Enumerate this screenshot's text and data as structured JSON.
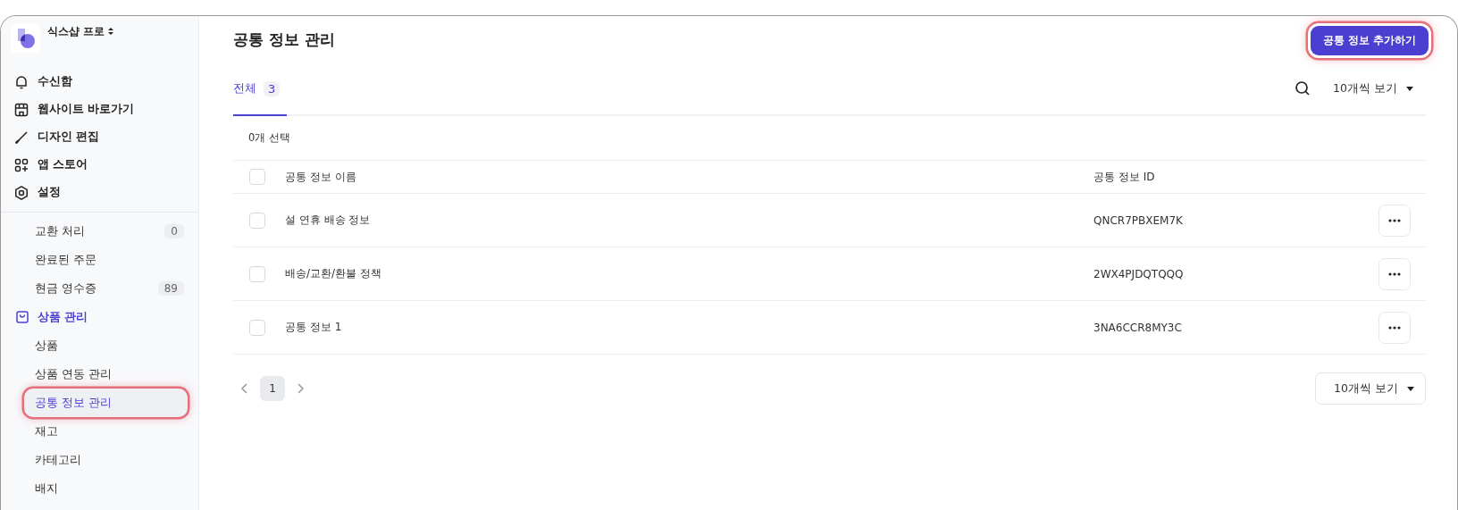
{
  "sidebar": {
    "store_name": "식스샵 프로",
    "nav": [
      {
        "label": "수신함"
      },
      {
        "label": "웹사이트 바로가기"
      },
      {
        "label": "디자인 편집"
      },
      {
        "label": "앱 스토어"
      },
      {
        "label": "설정"
      }
    ],
    "order_items": [
      {
        "label": "교환 처리",
        "count": "0",
        "selected": false
      },
      {
        "label": "완료된 주문",
        "selected": false
      },
      {
        "label": "현금 영수증",
        "count": "89",
        "selected": false
      }
    ],
    "product_section": {
      "label": "상품 관리",
      "selected": true,
      "children": [
        {
          "label": "상품",
          "selected": false,
          "highlighted": false
        },
        {
          "label": "상품 연동 관리",
          "selected": false,
          "highlighted": false
        },
        {
          "label": "공통 정보 관리",
          "selected": true,
          "highlighted": true
        },
        {
          "label": "재고",
          "selected": false,
          "highlighted": false
        },
        {
          "label": "카테고리",
          "selected": false,
          "highlighted": false
        },
        {
          "label": "배지",
          "selected": false,
          "highlighted": false
        }
      ]
    }
  },
  "page": {
    "title": "공통 정보 관리",
    "add_button": {
      "label": "공통 정보 추가하기",
      "highlighted": true
    }
  },
  "tabs": [
    {
      "label": "전체",
      "count": "3",
      "selected": true
    }
  ],
  "page_size_top": "10개씩 보기",
  "selection": "0개 선택",
  "table": {
    "header_checked": false,
    "columns": [
      "공통 정보 이름",
      "공통 정보 ID"
    ],
    "rows": [
      {
        "name": "설 연휴 배송 정보",
        "id": "QNCR7PBXEM7K",
        "checked": false
      },
      {
        "name": "배송/교환/환불 정책",
        "id": "2WX4PJDQTQQQ",
        "checked": false
      },
      {
        "name": "공통 정보 1",
        "id": "3NA6CCR8MY3C",
        "checked": false
      }
    ]
  },
  "pagination": {
    "pages": [
      {
        "label": "1",
        "selected": true
      }
    ],
    "page_size": "10개씩 보기"
  }
}
